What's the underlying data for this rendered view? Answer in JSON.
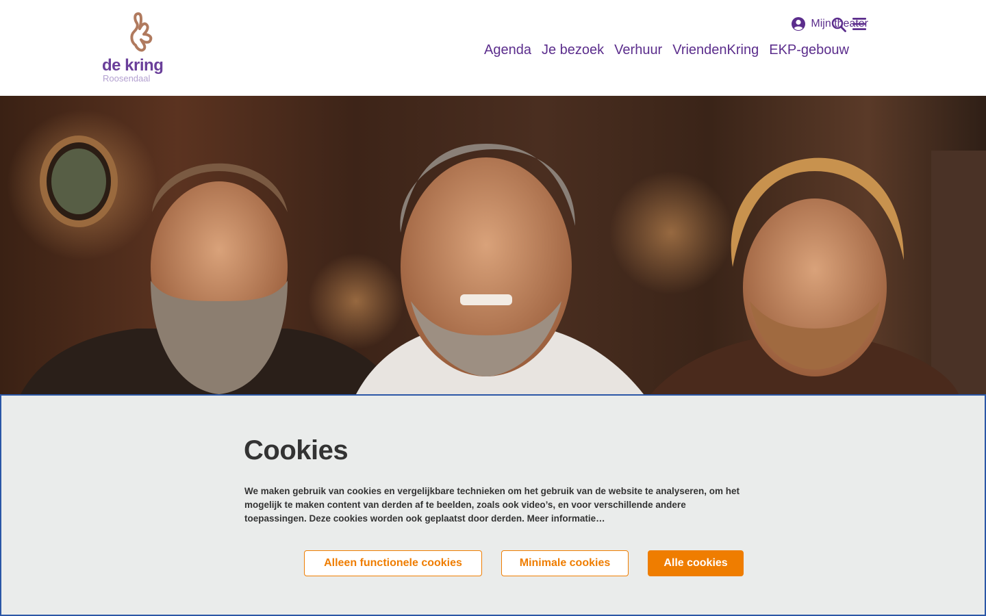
{
  "header": {
    "logo": {
      "name": "de kring",
      "city": "Roosendaal",
      "icon": "k-logo-icon",
      "brand_color": "#5b2d8c",
      "accent_color": "#b07a5e"
    },
    "account_label": "Mijn theater",
    "account_icon": "user-circle-icon",
    "search_icon": "search-icon",
    "menu_icon": "hamburger-menu-icon",
    "nav": [
      {
        "label": "Agenda"
      },
      {
        "label": "Je bezoek"
      },
      {
        "label": "Verhuur"
      },
      {
        "label": "VriendenKring"
      },
      {
        "label": "EKP-gebouw"
      }
    ]
  },
  "hero": {
    "alt_icon": "hero-photo"
  },
  "cookie_banner": {
    "title": "Cookies",
    "text": "We maken gebruik van cookies en vergelijkbare technieken om het gebruik van de website te analyseren, om het mogelijk te maken content van derden af te beelden, zoals ook video’s, en voor verschillende andere toepassingen. Deze cookies worden ook geplaatst door derden. Meer informatie…",
    "buttons": {
      "functional": "Alleen functionele cookies",
      "minimal": "Minimale cookies",
      "all": "Alle cookies"
    },
    "colors": {
      "background": "#eaeceb",
      "accent": "#ef7d00",
      "border": "#2b57a6"
    }
  }
}
